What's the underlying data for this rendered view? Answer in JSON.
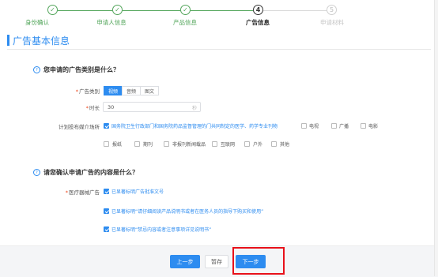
{
  "colors": {
    "accent": "#2d8cf0",
    "done": "#52a55a",
    "highlight": "#e8111a"
  },
  "steps": [
    {
      "label": "身份确认",
      "symbol": "✓",
      "state": "done"
    },
    {
      "label": "申请人信息",
      "symbol": "✓",
      "state": "done"
    },
    {
      "label": "产品信息",
      "symbol": "✓",
      "state": "done"
    },
    {
      "label": "广告信息",
      "symbol": "4",
      "state": "current"
    },
    {
      "label": "申请材料",
      "symbol": "5",
      "state": "todo"
    }
  ],
  "section": {
    "title": "广告基本信息"
  },
  "q1": {
    "icon": "question-circle-icon",
    "text": "您申请的广告类别是什么？",
    "category": {
      "label": "广告类别",
      "options": [
        "视频",
        "音频",
        "图文"
      ],
      "selected": "视频"
    },
    "duration": {
      "label": "时长",
      "value": "30",
      "unit": "秒"
    },
    "media": {
      "label": "计划投布媒介场所",
      "options": [
        {
          "label": "国务院卫生行政部门和国务院药品监督管理的门共同制定的医学、药学专业刊物",
          "checked": true
        },
        {
          "label": "电视",
          "checked": false
        },
        {
          "label": "广播",
          "checked": false
        },
        {
          "label": "电影",
          "checked": false
        },
        {
          "label": "报纸",
          "checked": false
        },
        {
          "label": "期刊",
          "checked": false
        },
        {
          "label": "非报刊新闻载品",
          "checked": false
        },
        {
          "label": "互联网",
          "checked": false
        },
        {
          "label": "户外",
          "checked": false
        },
        {
          "label": "其他",
          "checked": false
        }
      ]
    }
  },
  "q2": {
    "icon": "question-circle-icon",
    "text": "请您确认申请广告的内容是什么？",
    "label": "医疗器械广告",
    "options": [
      {
        "label": "已显著标明广告批准文号",
        "checked": true
      },
      {
        "label": "已显著标明“请仔细阅读产品说明书或者在医务人员的指导下购买和使用”",
        "checked": true
      },
      {
        "label": "已显著标明“禁忌内容或者注意事项详见说明书”",
        "checked": true
      }
    ]
  },
  "footer": {
    "prev": "上一步",
    "save": "暂存",
    "next": "下一步"
  }
}
